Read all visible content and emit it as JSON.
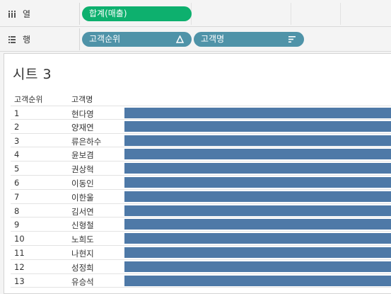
{
  "shelves": {
    "columns": {
      "label": "열",
      "icon": "columns-icon",
      "pills": [
        {
          "text": "합계(매출)",
          "color": "#0db06e"
        }
      ]
    },
    "rows": {
      "label": "행",
      "icon": "rows-icon",
      "pills": [
        {
          "text": "고객순위",
          "icon": "delta-icon",
          "color": "#4f93a8"
        },
        {
          "text": "고객명",
          "icon": "sort-descending-icon",
          "color": "#4f93a8"
        }
      ]
    }
  },
  "sheet": {
    "title": "시트 3",
    "headers": {
      "rank": "고객순위",
      "name": "고객명"
    },
    "bar_color": "#4e79a7",
    "rows": [
      {
        "rank": "1",
        "name": "현다영"
      },
      {
        "rank": "2",
        "name": "양재연"
      },
      {
        "rank": "3",
        "name": "류은하수"
      },
      {
        "rank": "4",
        "name": "윤보겸"
      },
      {
        "rank": "5",
        "name": "권상혁"
      },
      {
        "rank": "6",
        "name": "이동인"
      },
      {
        "rank": "7",
        "name": "이한울"
      },
      {
        "rank": "8",
        "name": "김서연"
      },
      {
        "rank": "9",
        "name": "신형철"
      },
      {
        "rank": "10",
        "name": "노희도"
      },
      {
        "rank": "11",
        "name": "나현지"
      },
      {
        "rank": "12",
        "name": "성정희"
      },
      {
        "rank": "13",
        "name": "유승석"
      }
    ]
  }
}
